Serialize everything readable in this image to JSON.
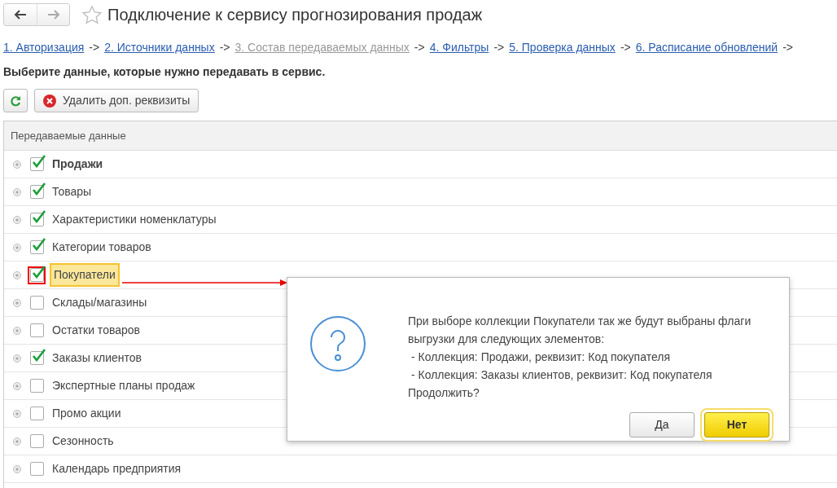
{
  "window": {
    "title": "Подключение к сервису прогнозирования продаж"
  },
  "steps": [
    {
      "label": "1. Авторизация",
      "selected": false,
      "separator": "->"
    },
    {
      "label": "2. Источники данных",
      "selected": false,
      "separator": "->"
    },
    {
      "label": "3. Состав передаваемых данных",
      "selected": true,
      "separator": "->"
    },
    {
      "label": "4. Фильтры",
      "selected": false,
      "separator": "->"
    },
    {
      "label": "5. Проверка данных",
      "selected": false,
      "separator": "->"
    },
    {
      "label": "6. Расписание обновлений",
      "selected": false,
      "separator": "->"
    }
  ],
  "instruction": "Выберите данные, которые нужно передавать в сервис.",
  "toolbar": {
    "delete_button": "Удалить доп. реквизиты"
  },
  "table": {
    "columns": [
      "Передаваемые данные"
    ],
    "rows": [
      {
        "label": "Продажи",
        "checked": true,
        "bold": true,
        "annotated": false
      },
      {
        "label": "Товары",
        "checked": true,
        "bold": false,
        "annotated": false
      },
      {
        "label": "Характеристики номенклатуры",
        "checked": true,
        "bold": false,
        "annotated": false
      },
      {
        "label": "Категории товаров",
        "checked": true,
        "bold": false,
        "annotated": false
      },
      {
        "label": "Покупатели",
        "checked": true,
        "bold": false,
        "annotated": true
      },
      {
        "label": "Склады/магазины",
        "checked": false,
        "bold": false,
        "annotated": false
      },
      {
        "label": "Остатки товаров",
        "checked": false,
        "bold": false,
        "annotated": false
      },
      {
        "label": "Заказы клиентов",
        "checked": true,
        "bold": false,
        "annotated": false
      },
      {
        "label": "Экспертные планы продаж",
        "checked": false,
        "bold": false,
        "annotated": false
      },
      {
        "label": "Промо акции",
        "checked": false,
        "bold": false,
        "annotated": false
      },
      {
        "label": "Сезонность",
        "checked": false,
        "bold": false,
        "annotated": false
      },
      {
        "label": "Календарь предприятия",
        "checked": false,
        "bold": false,
        "annotated": false
      }
    ]
  },
  "dialog": {
    "lines": [
      {
        "kind": "text",
        "text": "При выборе коллекции Покупатели так же будут выбраны флаги"
      },
      {
        "kind": "text",
        "text": "выгрузки для следующих элементов:"
      },
      {
        "kind": "bullet",
        "text": "- Коллекция: Продажи, реквизит: Код покупателя"
      },
      {
        "kind": "bullet",
        "text": "- Коллекция: Заказы клиентов, реквизит: Код покупателя"
      },
      {
        "kind": "text",
        "text": "Продолжить?"
      }
    ],
    "buttons": [
      {
        "label": "Да",
        "default": false
      },
      {
        "label": "Нет",
        "default": true
      }
    ]
  }
}
